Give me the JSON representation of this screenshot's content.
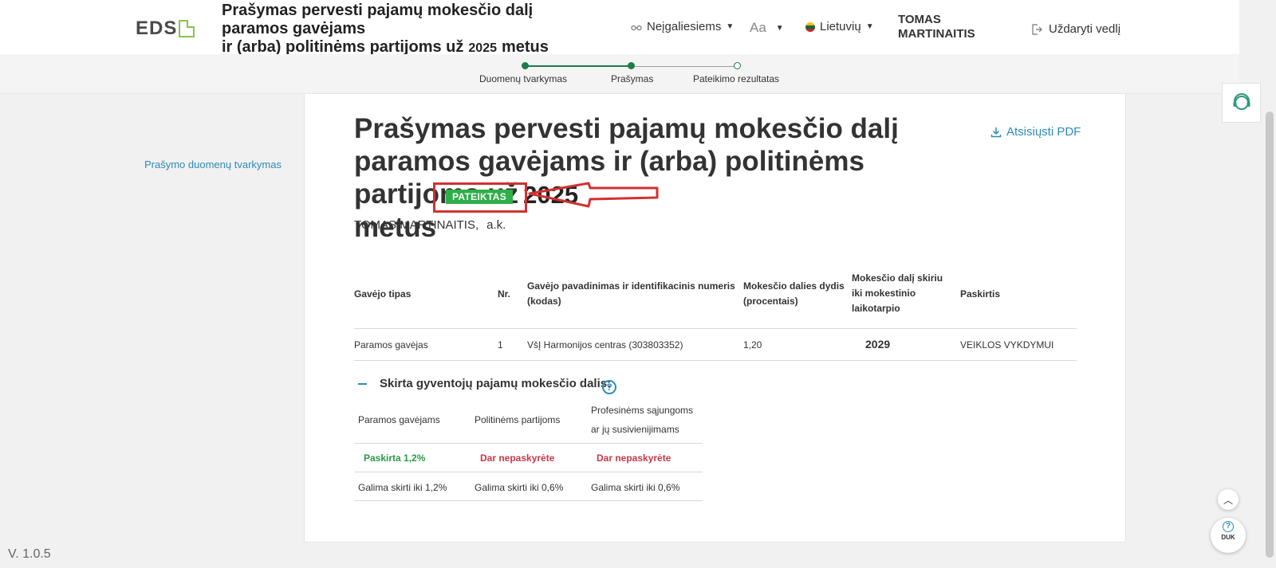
{
  "header": {
    "logo": "EDS",
    "title_line1": "Prašymas pervesti pajamų mokesčio dalį paramos gavėjams",
    "title_line2": "ir (arba) politinėms partijoms už",
    "title_year": "2025",
    "title_end": "metus",
    "accessibility": "Neįgaliesiems",
    "font_size": "Aa",
    "language": "Lietuvių",
    "user_line1": "TOMAS",
    "user_line2": "MARTINAITIS",
    "close": "Uždaryti vedlį"
  },
  "stepper": {
    "steps": [
      {
        "label": "Duomenų tvarkymas",
        "done": true
      },
      {
        "label": "Prašymas",
        "done": true
      },
      {
        "label": "Pateikimo rezultatas",
        "done": false
      }
    ]
  },
  "sidebar": {
    "link": "Prašymo duomenų tvarkymas"
  },
  "main": {
    "title_part1": "Prašymas pervesti pajamų mokesčio dalį paramos gavėjams ir (arba) politinėms partijoms už",
    "title_year": "2025",
    "title_end": "metus",
    "status": "PATEIKTAS",
    "download": "Atsisiųsti PDF",
    "person_name": "TOMAS MARTINAITIS,",
    "person_code_label": "a.k."
  },
  "table": {
    "headers": [
      "Gavėjo tipas",
      "Nr.",
      "Gavėjo pavadinimas ir identifikacinis numeris (kodas)",
      "Mokesčio dalies dydis (procentais)",
      "Mokesčio dalį skiriu iki mokestinio laikotarpio",
      "Paskirtis"
    ],
    "rows": [
      [
        "Paramos gavėjas",
        "1",
        "VšĮ Harmonijos centras (303803352)",
        "1,20",
        "2029",
        "VEIKLOS VYKDYMUI"
      ]
    ]
  },
  "allocation": {
    "title": "Skirta gyventojų pajamų mokesčio dalis:",
    "help": "?",
    "headers": [
      "Paramos gavėjams",
      "Politinėms partijoms",
      "Profesinėms sąjungoms ar jų susivienijimams"
    ],
    "status": [
      "Paskirta 1,2%",
      "Dar nepaskyrėte",
      "Dar nepaskyrėte"
    ],
    "limits": [
      "Galima skirti iki 1,2%",
      "Galima skirti iki 0,6%",
      "Galima skirti iki 0,6%"
    ]
  },
  "footer": {
    "version": "V. 1.0.5",
    "faq": "DUK"
  },
  "colors": {
    "accent": "#2b8bb8",
    "success": "#2fae4a",
    "step": "#1e7b4a",
    "warning": "#c9364b",
    "annotation": "#d23131"
  },
  "icons": [
    "glasses-icon",
    "flag-icon",
    "logout-icon",
    "download-icon",
    "help-icon",
    "support-icon",
    "chevron-up-icon"
  ]
}
